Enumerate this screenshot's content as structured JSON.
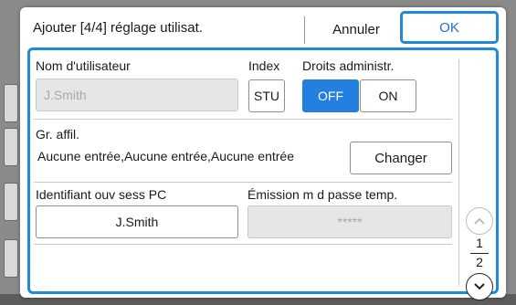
{
  "header": {
    "title": "Ajouter [4/4] réglage utilisat.",
    "cancel_label": "Annuler",
    "ok_label": "OK"
  },
  "user": {
    "name_label": "Nom d'utilisateur",
    "name_value": "J.Smith",
    "index_label": "Index",
    "index_value": "STU",
    "admin_label": "Droits administr.",
    "admin_off": "OFF",
    "admin_on": "ON",
    "admin_selected": "OFF"
  },
  "group": {
    "label": "Gr. affil.",
    "value": "Aucune entrée,Aucune entrée,Aucune entrée",
    "change_label": "Changer"
  },
  "login": {
    "pc_label": "Identifiant ouv sess PC",
    "pc_value": "J.Smith",
    "temp_pw_label": "Émission m d passe temp.",
    "temp_pw_value": "*****"
  },
  "pager": {
    "current": "1",
    "total": "2"
  },
  "colors": {
    "accent": "#1f8ad6",
    "active_button": "#2380e0"
  }
}
